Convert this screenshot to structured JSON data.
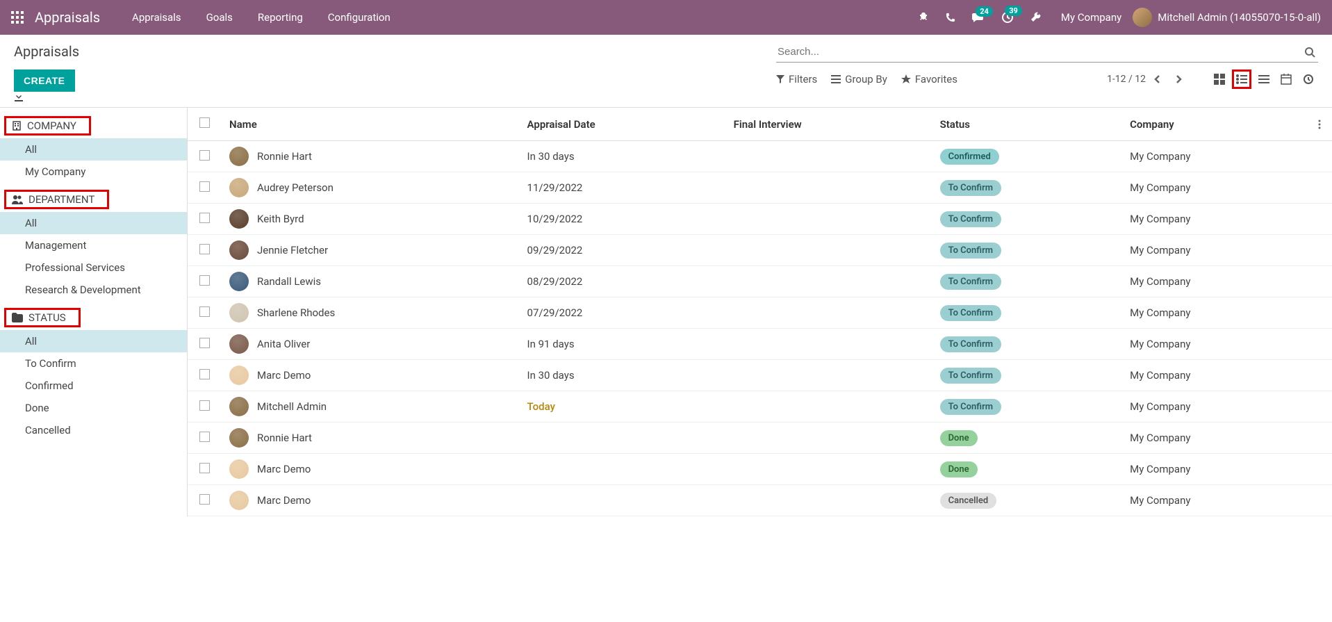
{
  "navbar": {
    "brand": "Appraisals",
    "menu": [
      "Appraisals",
      "Goals",
      "Reporting",
      "Configuration"
    ],
    "badge_messages": "24",
    "badge_activities": "39",
    "company": "My Company",
    "user": "Mitchell Admin (14055070-15-0-all)"
  },
  "breadcrumb": "Appraisals",
  "buttons": {
    "create": "CREATE"
  },
  "search": {
    "placeholder": "Search..."
  },
  "toolbar": {
    "filters": "Filters",
    "groupby": "Group By",
    "favorites": "Favorites",
    "pager": "1-12 / 12"
  },
  "sidebar": {
    "groups": [
      {
        "label": "COMPANY",
        "highlighted": true,
        "icon": "building",
        "items": [
          {
            "label": "All",
            "active": true
          },
          {
            "label": "My Company",
            "active": false
          }
        ]
      },
      {
        "label": "DEPARTMENT",
        "highlighted": true,
        "icon": "users",
        "items": [
          {
            "label": "All",
            "active": true
          },
          {
            "label": "Management",
            "active": false
          },
          {
            "label": "Professional Services",
            "active": false
          },
          {
            "label": "Research & Development",
            "active": false
          }
        ]
      },
      {
        "label": "STATUS",
        "highlighted": true,
        "icon": "folder",
        "items": [
          {
            "label": "All",
            "active": true
          },
          {
            "label": "To Confirm",
            "active": false
          },
          {
            "label": "Confirmed",
            "active": false
          },
          {
            "label": "Done",
            "active": false
          },
          {
            "label": "Cancelled",
            "active": false
          }
        ]
      }
    ]
  },
  "table": {
    "columns": [
      "Name",
      "Appraisal Date",
      "Final Interview",
      "Status",
      "Company"
    ],
    "rows": [
      {
        "name": "Ronnie Hart",
        "date": "In 30 days",
        "final": "",
        "status": "Confirmed",
        "statusClass": "confirmed",
        "company": "My Company",
        "avatar": "#8b6f47"
      },
      {
        "name": "Audrey Peterson",
        "date": "11/29/2022",
        "final": "",
        "status": "To Confirm",
        "statusClass": "toconfirm",
        "company": "My Company",
        "avatar": "#c9a87a"
      },
      {
        "name": "Keith Byrd",
        "date": "10/29/2022",
        "final": "",
        "status": "To Confirm",
        "statusClass": "toconfirm",
        "company": "My Company",
        "avatar": "#5a3e2b"
      },
      {
        "name": "Jennie Fletcher",
        "date": "09/29/2022",
        "final": "",
        "status": "To Confirm",
        "statusClass": "toconfirm",
        "company": "My Company",
        "avatar": "#6b4a3a"
      },
      {
        "name": "Randall Lewis",
        "date": "08/29/2022",
        "final": "",
        "status": "To Confirm",
        "statusClass": "toconfirm",
        "company": "My Company",
        "avatar": "#3a5a7a"
      },
      {
        "name": "Sharlene Rhodes",
        "date": "07/29/2022",
        "final": "",
        "status": "To Confirm",
        "statusClass": "toconfirm",
        "company": "My Company",
        "avatar": "#d0c4b0"
      },
      {
        "name": "Anita Oliver",
        "date": "In 91 days",
        "final": "",
        "status": "To Confirm",
        "statusClass": "toconfirm",
        "company": "My Company",
        "avatar": "#7a5a4a"
      },
      {
        "name": "Marc Demo",
        "date": "In 30 days",
        "final": "",
        "status": "To Confirm",
        "statusClass": "toconfirm",
        "company": "My Company",
        "avatar": "#e8c9a0"
      },
      {
        "name": "Mitchell Admin",
        "date": "Today",
        "dateClass": "today",
        "final": "",
        "status": "To Confirm",
        "statusClass": "toconfirm",
        "company": "My Company",
        "avatar": "#8b6f47"
      },
      {
        "name": "Ronnie Hart",
        "date": "",
        "final": "",
        "status": "Done",
        "statusClass": "done",
        "company": "My Company",
        "avatar": "#8b6f47"
      },
      {
        "name": "Marc Demo",
        "date": "",
        "final": "",
        "status": "Done",
        "statusClass": "done",
        "company": "My Company",
        "avatar": "#e8c9a0"
      },
      {
        "name": "Marc Demo",
        "date": "",
        "final": "",
        "status": "Cancelled",
        "statusClass": "cancelled",
        "company": "My Company",
        "avatar": "#e8c9a0"
      }
    ]
  }
}
